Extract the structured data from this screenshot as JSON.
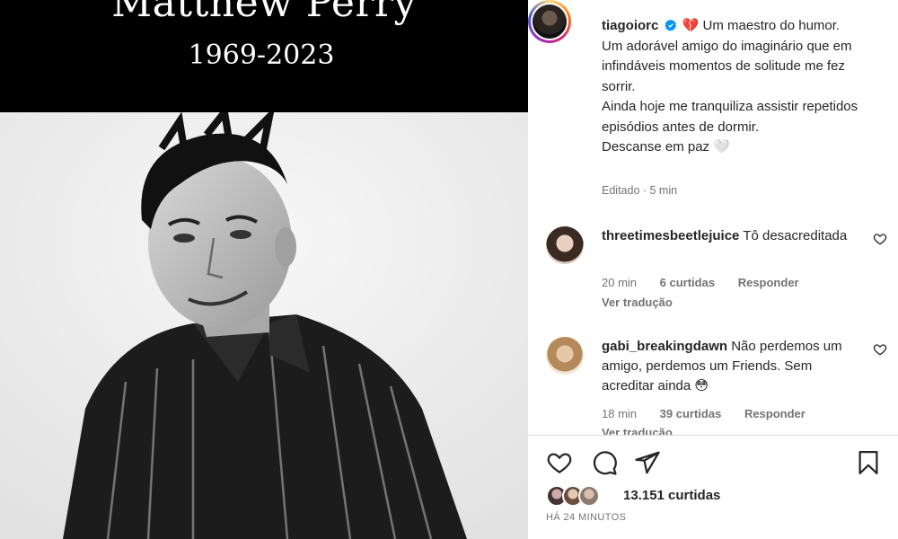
{
  "media": {
    "name": "Matthew Perry",
    "years": "1969-2023"
  },
  "author": {
    "username": "tiagoiorc",
    "verified_icon": "verified-badge-icon",
    "caption_emoji": "💔",
    "caption_lines": [
      "Um maestro do humor.",
      "Um adorável amigo do imaginário que em infindáveis momentos de solitude me fez sorrir.",
      "Ainda hoje me tranquiliza assistir repetidos episódios antes de dormir.",
      "Descanse em paz 🤍"
    ],
    "meta": "Editado · 5 min"
  },
  "comments": [
    {
      "username": "threetimesbeetlejuice",
      "text": "Tô desacreditada",
      "time": "20 min",
      "likes": "6 curtidas",
      "reply": "Responder",
      "translate": "Ver tradução"
    },
    {
      "username": "gabi_breakingdawn",
      "text": "Não perdemos um amigo, perdemos um Friends. Sem acreditar ainda 😳",
      "time": "18 min",
      "likes": "39 curtidas",
      "reply": "Responder",
      "translate": "Ver tradução"
    }
  ],
  "actions": {
    "like": "heart-icon",
    "comment": "comment-icon",
    "share": "share-icon",
    "save": "bookmark-icon"
  },
  "likes_count": "13.151 curtidas",
  "timestamp": "HÁ 24 MINUTOS",
  "colors": {
    "text": "#262626",
    "secondary": "#737373",
    "verified": "#0095f6",
    "divider": "#dbdbdb"
  }
}
